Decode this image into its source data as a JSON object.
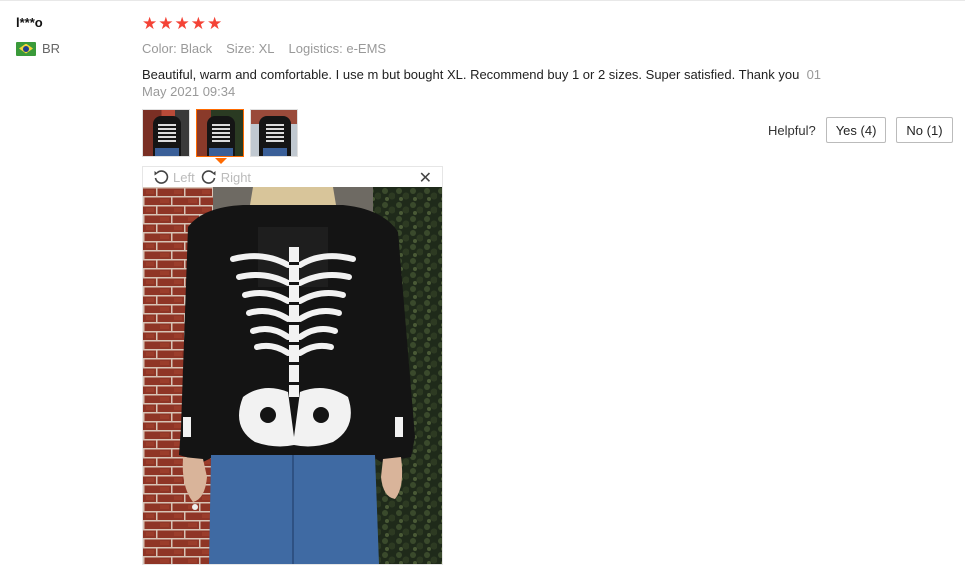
{
  "review": {
    "user_name": "l***o",
    "country_code": "BR",
    "flag_icon": "brazil-flag-icon",
    "rating": 5,
    "stars": [
      "★",
      "★",
      "★",
      "★",
      "★"
    ],
    "attributes": {
      "color_key": "Color:",
      "color_value": "Black",
      "size_key": "Size:",
      "size_value": "XL",
      "logistics_key": "Logistics:",
      "logistics_value": "e-EMS"
    },
    "text": "Beautiful, warm and comfortable. I use m but bought XL. Recommend buy 1 or 2 sizes. Super satisfied. Thank you",
    "date_part1": "01",
    "date_part2": "May 2021 09:34",
    "thumbnail_count": 3,
    "active_thumbnail": 2
  },
  "viewer": {
    "rotate_left_label": "Left",
    "rotate_right_label": "Right",
    "close_glyph": "✕"
  },
  "helpful": {
    "label": "Helpful?",
    "yes_label": "Yes (4)",
    "no_label": "No (1)"
  },
  "colors": {
    "star": "#f44336",
    "active_border": "#ff6a00"
  }
}
